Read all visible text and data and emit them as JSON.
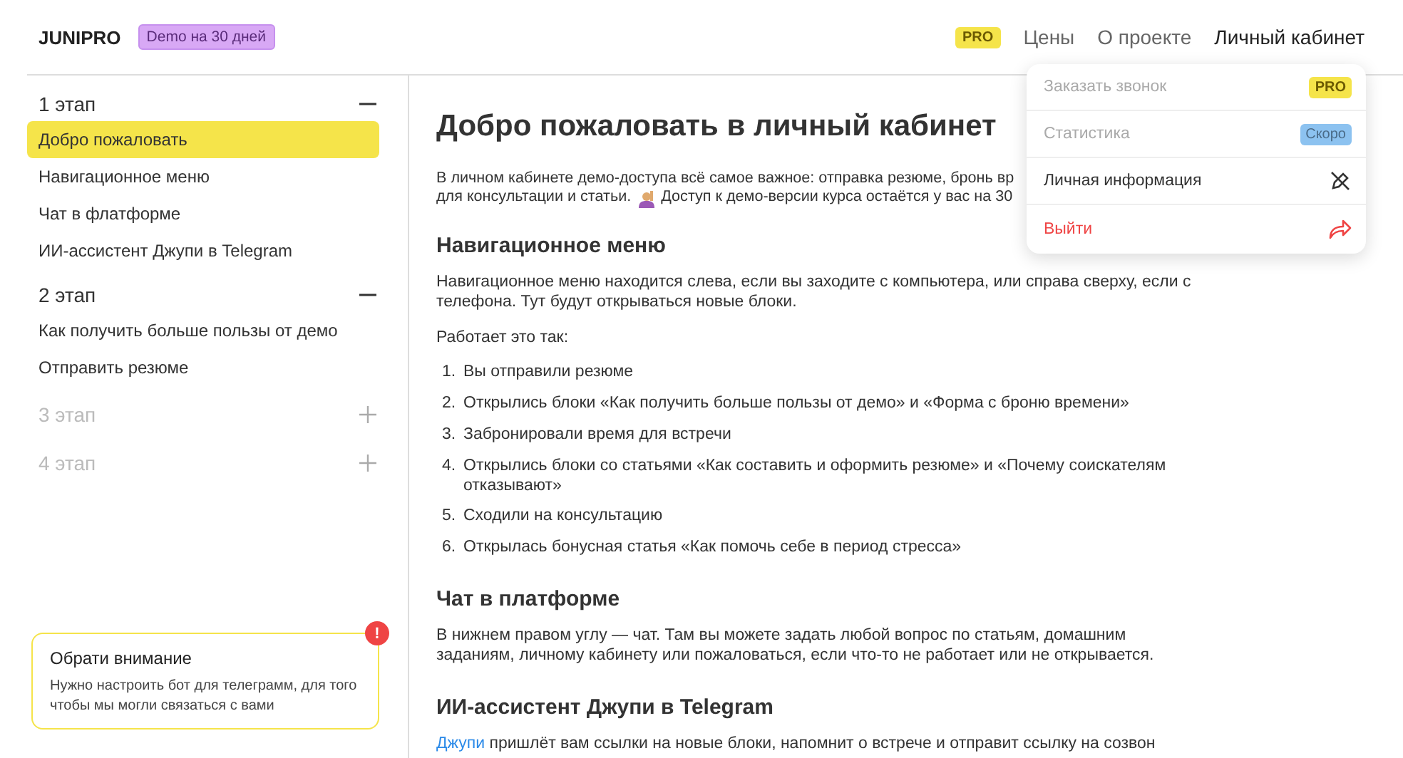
{
  "header": {
    "logo": "JUNIPRO",
    "demo_badge": "Demo на 30 дней",
    "nav": [
      {
        "kind": "badge",
        "label": "PRO"
      },
      {
        "kind": "link",
        "label": "Цены",
        "selected": false
      },
      {
        "kind": "link",
        "label": "О проекте",
        "selected": false
      },
      {
        "kind": "link",
        "label": "Личный кабинет",
        "selected": true
      }
    ]
  },
  "account_menu": [
    {
      "label": "Заказать звонок",
      "disabled": true,
      "kind": "pro",
      "tag": "PRO"
    },
    {
      "label": "Статистика",
      "disabled": true,
      "kind": "soon",
      "tag": "Скоро"
    },
    {
      "label": "Личная информация",
      "disabled": false,
      "kind": "edit"
    },
    {
      "label": "Выйти",
      "disabled": false,
      "kind": "logout"
    }
  ],
  "sidebar": {
    "stages": [
      {
        "title": "1 этап",
        "expanded": true,
        "disabled": false,
        "items": [
          {
            "label": "Добро пожаловать",
            "selected": true
          },
          {
            "label": "Навигационное меню",
            "selected": false
          },
          {
            "label": "Чат в флатформе",
            "selected": false
          },
          {
            "label": "ИИ-ассистент Джупи в Telegram",
            "selected": false
          }
        ]
      },
      {
        "title": "2 этап",
        "expanded": true,
        "disabled": false,
        "items": [
          {
            "label": "Как получить больше пользы от демо",
            "selected": false
          },
          {
            "label": "Отправить резюме",
            "selected": false
          }
        ]
      },
      {
        "title": "3 этап",
        "expanded": false,
        "disabled": true
      },
      {
        "title": "4 этап",
        "expanded": false,
        "disabled": true
      }
    ],
    "notice": {
      "title": "Обрати внимание",
      "text": "Нужно настроить бот для телеграмм, для того чтобы мы могли связаться с вами",
      "badge": "!"
    }
  },
  "content": {
    "title": "Добро пожаловать в личный кабинет",
    "intro": [
      "В личном кабинете демо-доступа всё самое важное: отправка резюме, бронь вр",
      "для консультации и статьи.",
      "Доступ к демо-версии курса остаётся у вас на 30"
    ],
    "sections": [
      {
        "heading": "Навигационное меню",
        "paragraphs": [
          "Навигационное меню находится слева, если вы заходите с компьютера, или справа сверху, если с телефона. Тут будут открываться новые блоки.",
          "Работает это так:"
        ],
        "list": [
          {
            "number": "1.",
            "text": "Вы отправили резюме"
          },
          {
            "number": "2.",
            "text": "Открылись блоки «Как получить больше пользы от демо» и «Форма с броню времени»"
          },
          {
            "number": "3.",
            "text": "Забронировали время для встречи"
          },
          {
            "number": "4.",
            "text": "Открылись блоки со статьями «Как составить и оформить резюме» и «Почему соискателям отказывают»"
          },
          {
            "number": "5.",
            "text": "Сходили на консультацию"
          },
          {
            "number": "6.",
            "text": "Открылась бонусная статья «Как помочь себе в период стресса»"
          }
        ]
      },
      {
        "heading": "Чат в платформе",
        "paragraphs": [
          "В нижнем правом углу — чат. Там вы можете задать любой вопрос по статьям, домашним заданиям, личному кабинету или пожаловаться, если что-то не работает или не открывается."
        ]
      },
      {
        "heading": "ИИ-ассистент Джупи в Telegram",
        "link": "Джупи",
        "paragraphs": [
          "пришлёт вам ссылки на новые блоки, напомнит о встрече и отправит ссылку на созвон"
        ]
      }
    ]
  }
}
